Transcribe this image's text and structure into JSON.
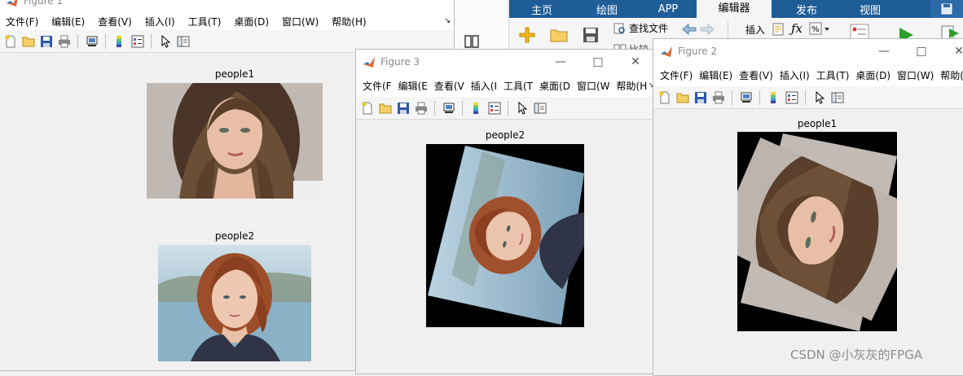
{
  "desktop": {
    "tabs": [
      "主页",
      "绘图",
      "APP",
      "编辑器",
      "发布",
      "视图"
    ],
    "ribbon": {
      "find_files": "查找文件",
      "compare": "比较",
      "insert": "插入"
    }
  },
  "figure1": {
    "title": "Figure 1",
    "menus": [
      "文件(F)",
      "编辑(E)",
      "查看(V)",
      "插入(I)",
      "工具(T)",
      "桌面(D)",
      "窗口(W)",
      "帮助(H)"
    ],
    "axes": [
      {
        "title": "people1"
      },
      {
        "title": "people2"
      }
    ]
  },
  "figure3": {
    "title": "Figure 3",
    "menus": [
      "文件(F",
      "编辑(E",
      "查看(V",
      "插入(I",
      "工具(T",
      "桌面(D",
      "窗口(W",
      "帮助(H"
    ],
    "axes_title": "people2"
  },
  "figure2": {
    "title": "Figure 2",
    "menus": [
      "文件(F)",
      "编辑(E)",
      "查看(V)",
      "插入(I)",
      "工具(T)",
      "桌面(D)",
      "窗口(W)",
      "帮助(H)"
    ],
    "axes_title": "people1"
  },
  "watermark": "CSDN @小灰灰的FPGA",
  "icons": {
    "toolbar": [
      "new-figure-icon",
      "open-file-icon",
      "save-icon",
      "print-icon",
      "link-plot-icon",
      "colorbar-icon",
      "legend-icon",
      "pointer-icon",
      "property-editor-icon"
    ],
    "window": [
      "minimize-icon",
      "maximize-icon",
      "close-icon"
    ]
  },
  "colors": {
    "desktop_tab_bar": "#1f5d98",
    "figure_bg": "#f0f0f0"
  }
}
